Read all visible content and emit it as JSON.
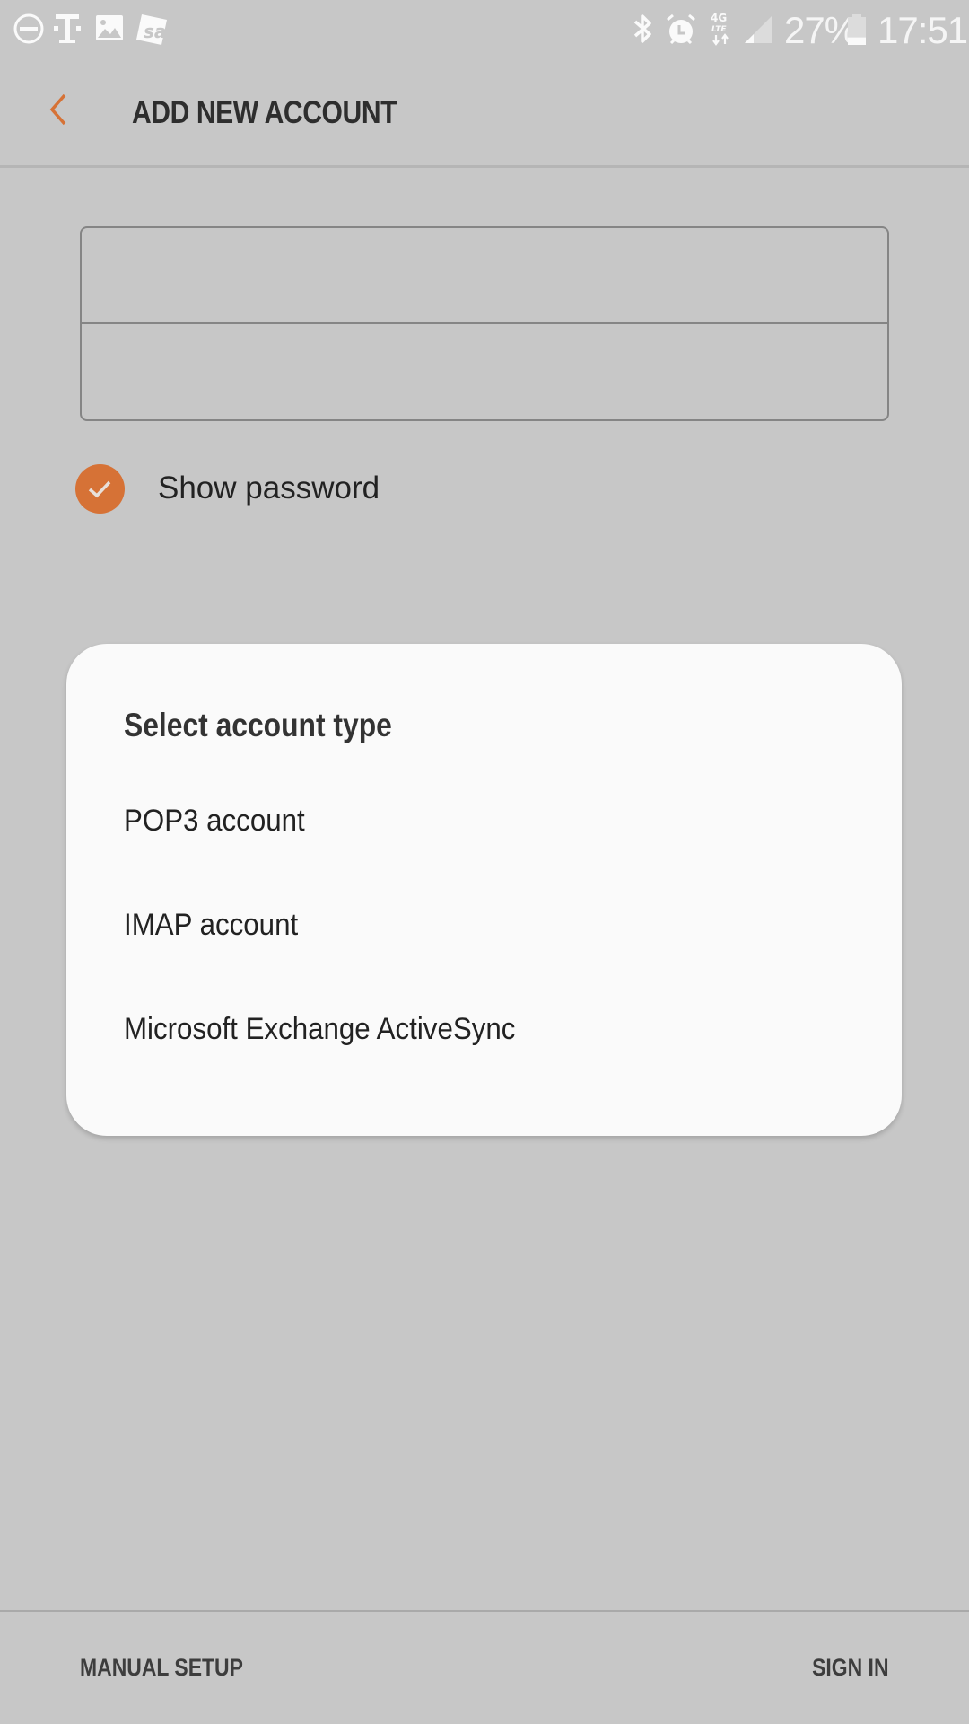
{
  "status_bar": {
    "left_icons": [
      "do-not-disturb-icon",
      "t-mobile-icon",
      "gallery-icon",
      "sd-card-icon"
    ],
    "right_icons": [
      "bluetooth-icon",
      "alarm-icon",
      "4g-lte-icon",
      "signal-icon",
      "battery-icon"
    ],
    "network_label_top": "4G",
    "network_label_bottom": "LTE",
    "battery_percent": "27%",
    "battery_level": 0.27,
    "time": "17:51"
  },
  "header": {
    "back_icon": "chevron-left-icon",
    "title": "ADD NEW ACCOUNT"
  },
  "form": {
    "email": {
      "value": "",
      "placeholder": ""
    },
    "password": {
      "value": "",
      "placeholder": ""
    },
    "show_password": {
      "label": "Show password",
      "checked": true
    }
  },
  "dialog": {
    "title": "Select account type",
    "options": [
      {
        "label": "POP3 account"
      },
      {
        "label": "IMAP account"
      },
      {
        "label": "Microsoft Exchange ActiveSync"
      }
    ]
  },
  "footer": {
    "manual_setup_label": "MANUAL SETUP",
    "sign_in_label": "SIGN IN"
  },
  "colors": {
    "accent": "#d67236",
    "background": "#c7c7c7",
    "dialog_background": "#fafafa",
    "text_primary": "#222222"
  }
}
